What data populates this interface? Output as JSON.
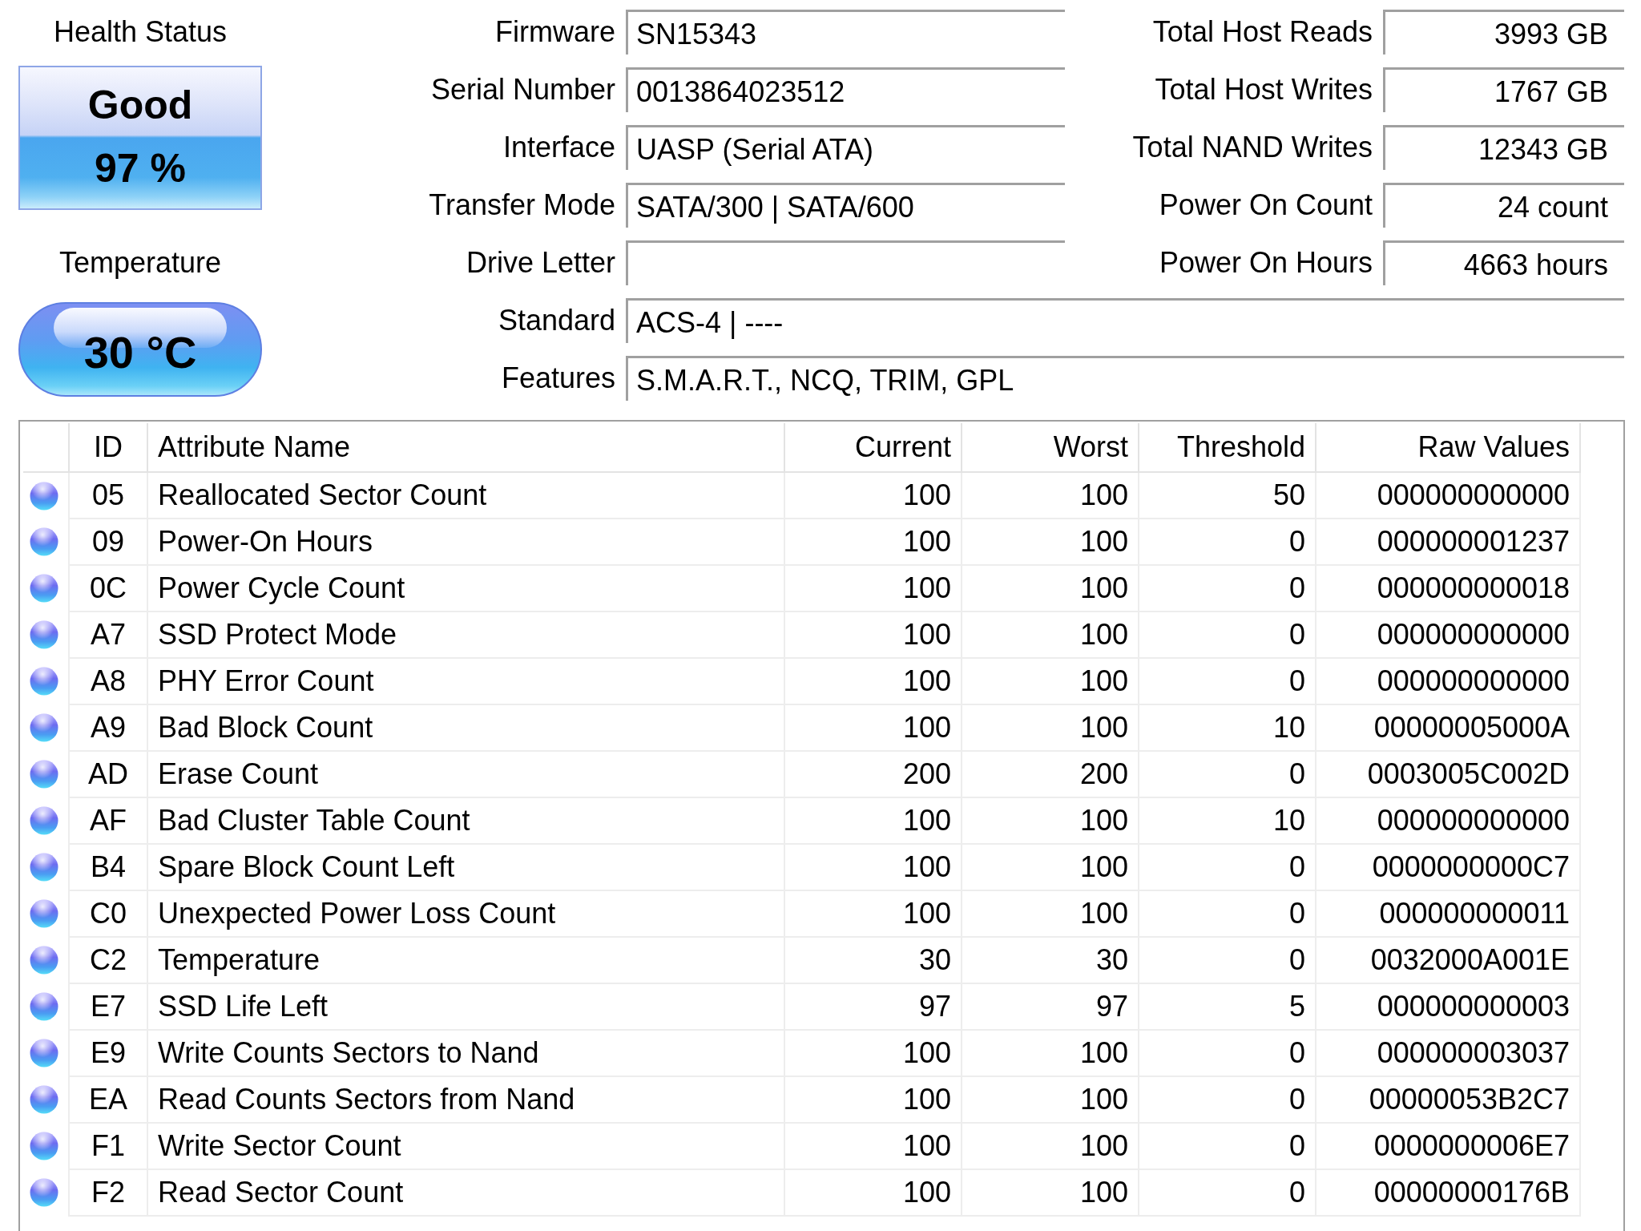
{
  "health": {
    "label": "Health Status",
    "status": "Good",
    "percent": "97 %"
  },
  "temperature": {
    "label": "Temperature",
    "value": "30 °C"
  },
  "info_left": [
    {
      "label": "Firmware",
      "value": "SN15343"
    },
    {
      "label": "Serial Number",
      "value": "0013864023512"
    },
    {
      "label": "Interface",
      "value": "UASP (Serial ATA)"
    },
    {
      "label": "Transfer Mode",
      "value": "SATA/300 | SATA/600"
    },
    {
      "label": "Drive Letter"
    }
  ],
  "info_right": [
    {
      "label": "Total Host Reads",
      "value": "3993 GB"
    },
    {
      "label": "Total Host Writes",
      "value": "1767 GB"
    },
    {
      "label": "Total NAND Writes",
      "value": "12343 GB"
    },
    {
      "label": "Power On Count",
      "value": "24 count"
    },
    {
      "label": "Power On Hours",
      "value": "4663 hours"
    }
  ],
  "info_wide": [
    {
      "label": "Standard",
      "value": "ACS-4 | ----"
    },
    {
      "label": "Features",
      "value": "S.M.A.R.T., NCQ, TRIM, GPL"
    }
  ],
  "table": {
    "columns": [
      "ID",
      "Attribute Name",
      "Current",
      "Worst",
      "Threshold",
      "Raw Values"
    ],
    "rows": [
      [
        "05",
        "Reallocated Sector Count",
        "100",
        "100",
        "50",
        "000000000000"
      ],
      [
        "09",
        "Power-On Hours",
        "100",
        "100",
        "0",
        "000000001237"
      ],
      [
        "0C",
        "Power Cycle Count",
        "100",
        "100",
        "0",
        "000000000018"
      ],
      [
        "A7",
        "SSD Protect Mode",
        "100",
        "100",
        "0",
        "000000000000"
      ],
      [
        "A8",
        "PHY Error Count",
        "100",
        "100",
        "0",
        "000000000000"
      ],
      [
        "A9",
        "Bad Block Count",
        "100",
        "100",
        "10",
        "00000005000A"
      ],
      [
        "AD",
        "Erase Count",
        "200",
        "200",
        "0",
        "0003005C002D"
      ],
      [
        "AF",
        "Bad Cluster Table Count",
        "100",
        "100",
        "10",
        "000000000000"
      ],
      [
        "B4",
        "Spare Block Count Left",
        "100",
        "100",
        "0",
        "0000000000C7"
      ],
      [
        "C0",
        "Unexpected Power Loss Count",
        "100",
        "100",
        "0",
        "000000000011"
      ],
      [
        "C2",
        "Temperature",
        "30",
        "30",
        "0",
        "0032000A001E"
      ],
      [
        "E7",
        "SSD Life Left",
        "97",
        "97",
        "5",
        "000000000003"
      ],
      [
        "E9",
        "Write Counts Sectors to Nand",
        "100",
        "100",
        "0",
        "000000003037"
      ],
      [
        "EA",
        "Read Counts Sectors from Nand",
        "100",
        "100",
        "0",
        "00000053B2C7"
      ],
      [
        "F1",
        "Write Sector Count",
        "100",
        "100",
        "0",
        "0000000006E7"
      ],
      [
        "F2",
        "Read Sector Count",
        "100",
        "100",
        "0",
        "00000000176B"
      ]
    ]
  }
}
